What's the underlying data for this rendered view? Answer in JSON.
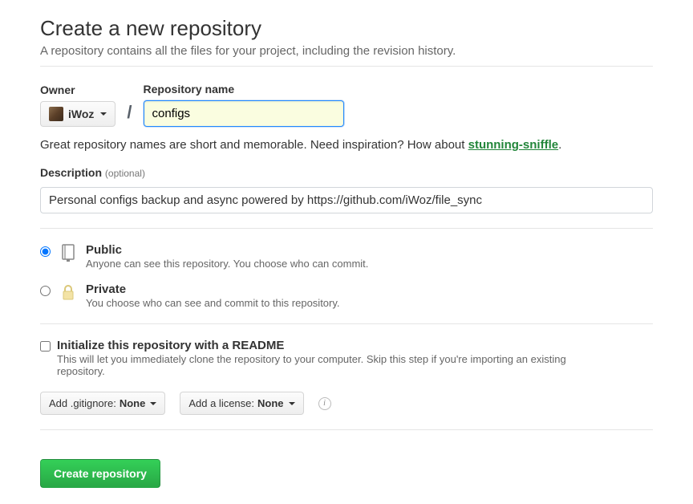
{
  "header": {
    "title": "Create a new repository",
    "subtitle": "A repository contains all the files for your project, including the revision history."
  },
  "owner": {
    "label": "Owner",
    "name": "iWoz"
  },
  "repo": {
    "label": "Repository name",
    "value": "configs"
  },
  "slash": "/",
  "hint": {
    "prefix": "Great repository names are short and memorable. Need inspiration? How about ",
    "suggestion": "stunning-sniffle",
    "suffix": "."
  },
  "description": {
    "label": "Description",
    "optional": "(optional)",
    "value": "Personal configs backup and async powered by https://github.com/iWoz/file_sync"
  },
  "visibility": {
    "public": {
      "title": "Public",
      "note": "Anyone can see this repository. You choose who can commit."
    },
    "private": {
      "title": "Private",
      "note": "You choose who can see and commit to this repository."
    }
  },
  "readme": {
    "title": "Initialize this repository with a README",
    "note": "This will let you immediately clone the repository to your computer. Skip this step if you're importing an existing repository."
  },
  "gitignore": {
    "label_prefix": "Add .gitignore: ",
    "value": "None"
  },
  "license": {
    "label_prefix": "Add a license: ",
    "value": "None"
  },
  "submit": "Create repository"
}
